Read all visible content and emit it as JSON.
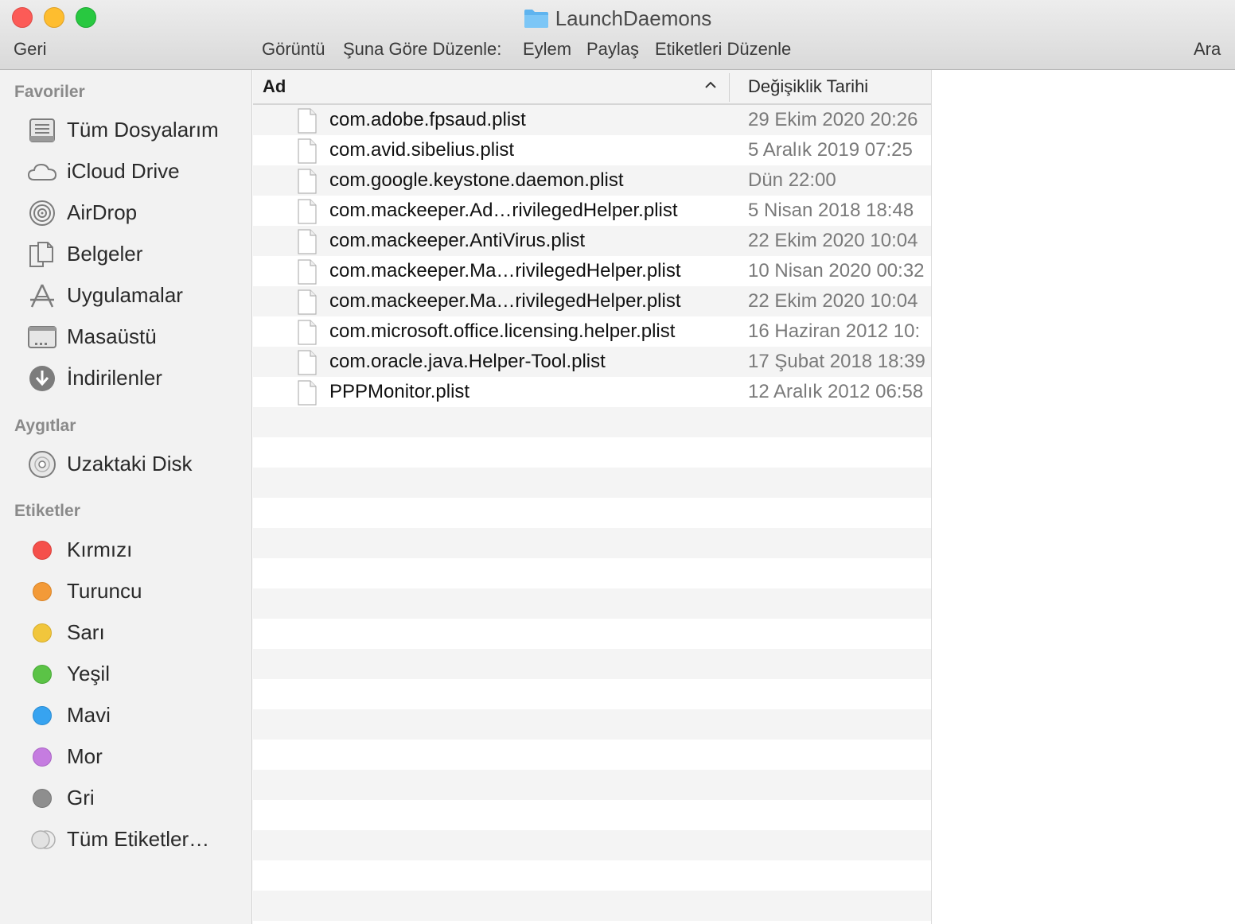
{
  "window": {
    "title": "LaunchDaemons"
  },
  "toolbar": {
    "back_label": "Geri",
    "view_label": "Görüntü",
    "arrange_label": "Şuna Göre Düzenle:",
    "action_label": "Eylem",
    "share_label": "Paylaş",
    "edit_tags_label": "Etiketleri Düzenle",
    "search_label": "Ara"
  },
  "sidebar": {
    "favorites_header": "Favoriler",
    "favorites": [
      {
        "label": "Tüm Dosyalarım",
        "icon": "all-files-icon"
      },
      {
        "label": "iCloud Drive",
        "icon": "cloud-icon"
      },
      {
        "label": "AirDrop",
        "icon": "airdrop-icon"
      },
      {
        "label": "Belgeler",
        "icon": "documents-icon"
      },
      {
        "label": "Uygulamalar",
        "icon": "applications-icon"
      },
      {
        "label": "Masaüstü",
        "icon": "desktop-icon"
      },
      {
        "label": "İndirilenler",
        "icon": "downloads-icon"
      }
    ],
    "devices_header": "Aygıtlar",
    "devices": [
      {
        "label": "Uzaktaki Disk",
        "icon": "disc-icon"
      }
    ],
    "tags_header": "Etiketler",
    "tags": [
      {
        "label": "Kırmızı",
        "color": "#f5504b"
      },
      {
        "label": "Turuncu",
        "color": "#f39a38"
      },
      {
        "label": "Sarı",
        "color": "#f1c63c"
      },
      {
        "label": "Yeşil",
        "color": "#5bc346"
      },
      {
        "label": "Mavi",
        "color": "#37a3f0"
      },
      {
        "label": "Mor",
        "color": "#c57ce0"
      },
      {
        "label": "Gri",
        "color": "#8e8e8e"
      },
      {
        "label": "Tüm Etiketler…",
        "color": "#e0e0e0"
      }
    ]
  },
  "list": {
    "columns": {
      "name": "Ad",
      "date": "Değişiklik Tarihi"
    },
    "files": [
      {
        "name": "com.adobe.fpsaud.plist",
        "date": "29 Ekim 2020 20:26"
      },
      {
        "name": "com.avid.sibelius.plist",
        "date": "5 Aralık 2019 07:25"
      },
      {
        "name": "com.google.keystone.daemon.plist",
        "date": "Dün 22:00"
      },
      {
        "name": "com.mackeeper.Ad…rivilegedHelper.plist",
        "date": "5 Nisan 2018 18:48"
      },
      {
        "name": "com.mackeeper.AntiVirus.plist",
        "date": "22 Ekim 2020 10:04"
      },
      {
        "name": "com.mackeeper.Ma…rivilegedHelper.plist",
        "date": "10 Nisan 2020 00:32"
      },
      {
        "name": "com.mackeeper.Ma…rivilegedHelper.plist",
        "date": "22 Ekim 2020 10:04"
      },
      {
        "name": "com.microsoft.office.licensing.helper.plist",
        "date": "16 Haziran 2012 10:"
      },
      {
        "name": "com.oracle.java.Helper-Tool.plist",
        "date": "17 Şubat 2018 18:39"
      },
      {
        "name": "PPPMonitor.plist",
        "date": "12 Aralık 2012 06:58"
      }
    ]
  }
}
